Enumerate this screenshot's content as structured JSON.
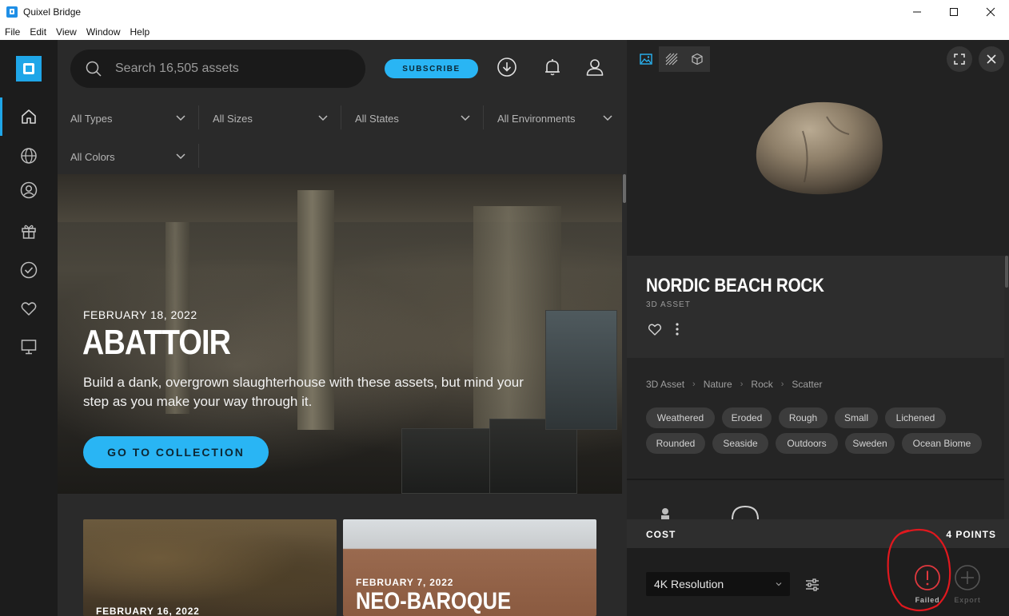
{
  "window": {
    "title": "Quixel Bridge",
    "controls": {
      "minimize": "—",
      "maximize": "☐",
      "close": "✕"
    }
  },
  "menu": [
    "File",
    "Edit",
    "View",
    "Window",
    "Help"
  ],
  "sidebar": {
    "items": [
      {
        "icon": "home-icon",
        "active": true
      },
      {
        "icon": "globe-icon"
      },
      {
        "icon": "user-icon"
      },
      {
        "icon": "gift-icon"
      },
      {
        "icon": "check-circle-icon"
      },
      {
        "icon": "heart-icon"
      },
      {
        "icon": "monitor-icon"
      }
    ]
  },
  "header": {
    "search_placeholder": "Search 16,505 assets",
    "subscribe_label": "SUBSCRIBE"
  },
  "filters": [
    "All Types",
    "All Sizes",
    "All States",
    "All Environments",
    "All Colors"
  ],
  "hero": {
    "date": "FEBRUARY 18, 2022",
    "title": "ABATTOIR",
    "description": "Build a dank, overgrown slaughterhouse with these assets, but mind your step as you make your way through it.",
    "cta": "GO TO COLLECTION"
  },
  "cards": [
    {
      "date": "FEBRUARY 16, 2022",
      "title": ""
    },
    {
      "date": "FEBRUARY 7, 2022",
      "title": "NEO-BAROQUE"
    }
  ],
  "asset": {
    "name": "NORDIC BEACH ROCK",
    "type": "3D ASSET",
    "breadcrumb": [
      "3D Asset",
      "Nature",
      "Rock",
      "Scatter"
    ],
    "tags": [
      "Weathered",
      "Eroded",
      "Rough",
      "Small",
      "Lichened",
      "Rounded",
      "Seaside",
      "Outdoors",
      "Sweden",
      "Ocean Biome"
    ]
  },
  "cost": {
    "label": "COST",
    "value": "4 POINTS"
  },
  "download": {
    "resolution": "4K Resolution",
    "failed_label": "Failed",
    "export_label": "Export"
  },
  "colors": {
    "accent": "#29b5f4",
    "failed": "#e0383e",
    "annotation": "#e0181e"
  }
}
